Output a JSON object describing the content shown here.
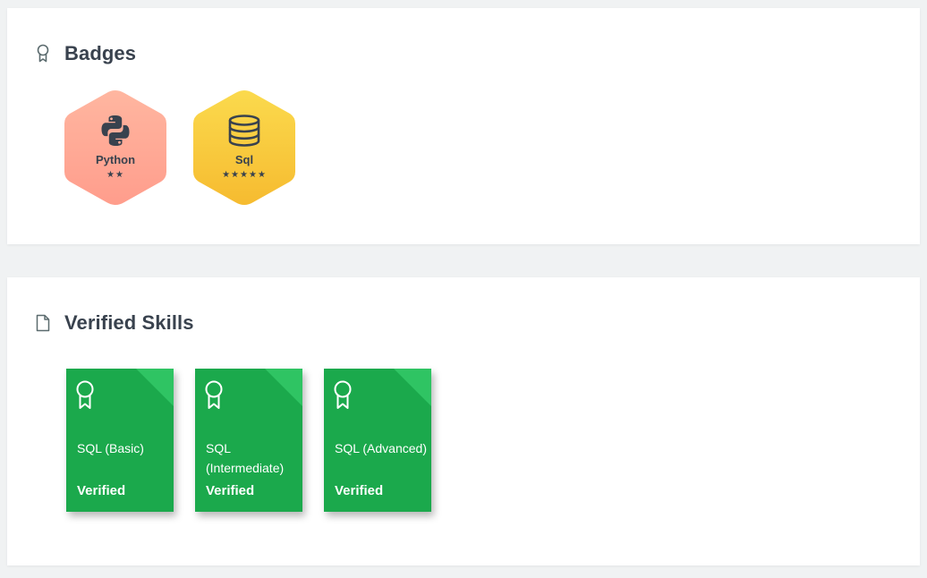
{
  "badges_section": {
    "title": "Badges",
    "icon": "ribbon-icon",
    "items": [
      {
        "name": "Python",
        "stars": "★★",
        "star_count": 2,
        "icon": "python-icon",
        "color_top": "#ffb49c",
        "color_bottom": "#ff9f8d"
      },
      {
        "name": "Sql",
        "stars": "★★★★★",
        "star_count": 5,
        "icon": "database-icon",
        "color_top": "#fad84a",
        "color_bottom": "#f6bd32"
      }
    ]
  },
  "skills_section": {
    "title": "Verified Skills",
    "icon": "document-icon",
    "items": [
      {
        "name": "SQL (Basic)",
        "status": "Verified",
        "icon": "ribbon-icon"
      },
      {
        "name": "SQL (Intermediate)",
        "status": "Verified",
        "icon": "ribbon-icon"
      },
      {
        "name": "SQL (Advanced)",
        "status": "Verified",
        "icon": "ribbon-icon"
      }
    ],
    "card_color": "#1ba94c",
    "fold_color": "#2fc463"
  }
}
